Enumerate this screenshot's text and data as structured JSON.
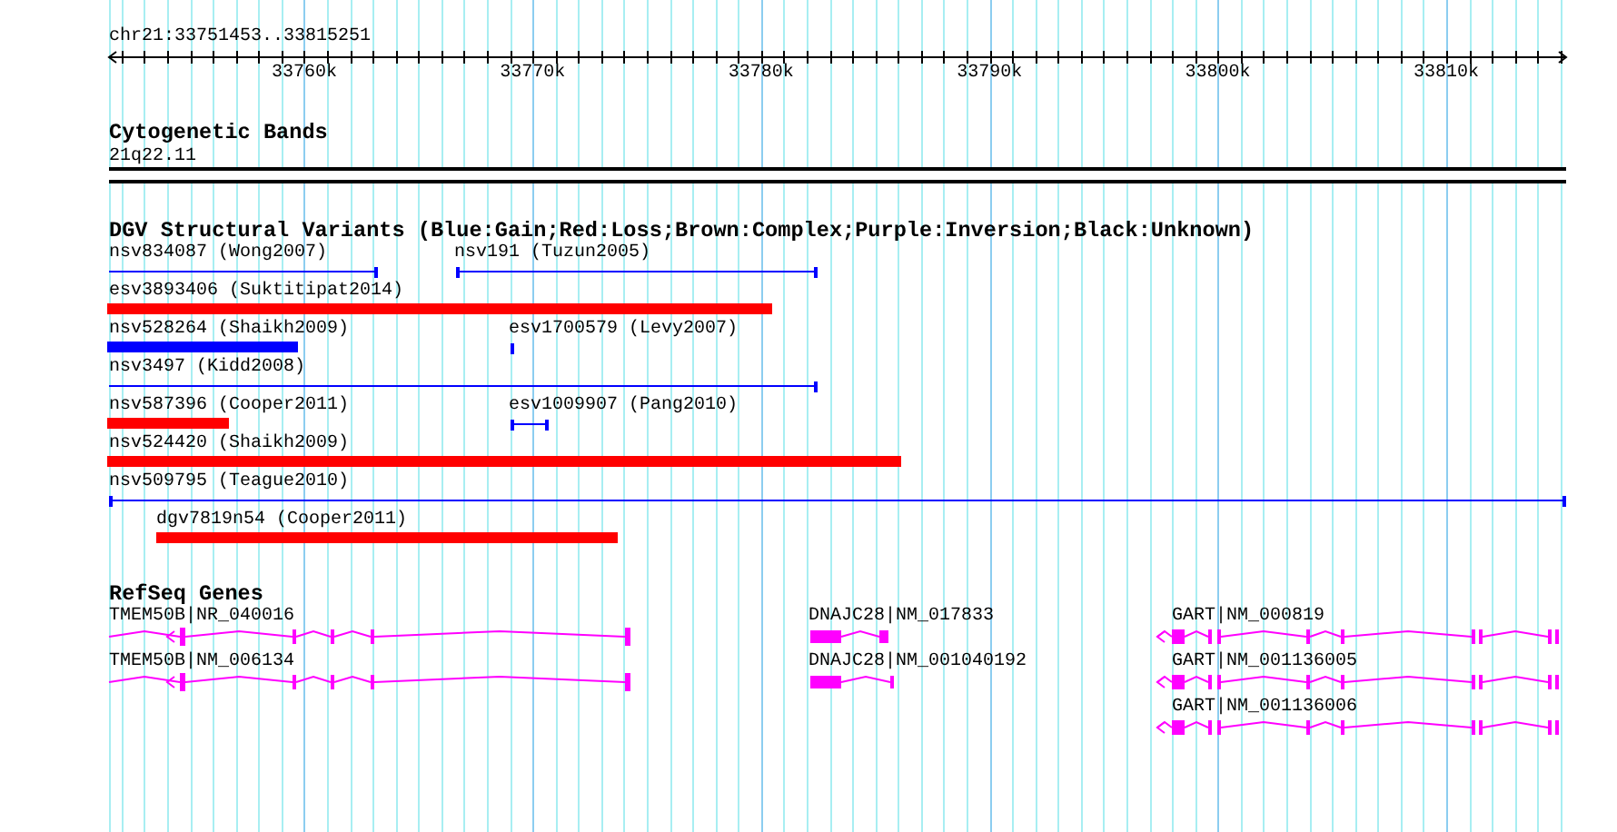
{
  "position": "chr21:33751453..33815251",
  "ruler": {
    "ticks": [
      "33760k",
      "33770k",
      "33780k",
      "33790k",
      "33800k",
      "33810k"
    ]
  },
  "cytogenetic_bands": {
    "title": "Cytogenetic Bands",
    "band": "21q22.11"
  },
  "dgv": {
    "title": "DGV Structural Variants (Blue:Gain;Red:Loss;Brown:Complex;Purple:Inversion;Black:Unknown)",
    "rows": [
      {
        "features": [
          {
            "label": "nsv834087 (Wong2007)",
            "color": "#0000ff",
            "kind": "line"
          },
          {
            "label": "nsv191 (Tuzun2005)",
            "color": "#0000ff",
            "kind": "line"
          }
        ]
      },
      {
        "features": [
          {
            "label": "esv3893406 (Suktitipat2014)",
            "color": "#ff0000",
            "kind": "bar"
          }
        ]
      },
      {
        "features": [
          {
            "label": "nsv528264 (Shaikh2009)",
            "color": "#0000ff",
            "kind": "bar"
          },
          {
            "label": "esv1700579 (Levy2007)",
            "color": "#0000ff",
            "kind": "line"
          }
        ]
      },
      {
        "features": [
          {
            "label": "nsv3497 (Kidd2008)",
            "color": "#0000ff",
            "kind": "line"
          }
        ]
      },
      {
        "features": [
          {
            "label": "nsv587396 (Cooper2011)",
            "color": "#ff0000",
            "kind": "bar"
          },
          {
            "label": "esv1009907 (Pang2010)",
            "color": "#0000ff",
            "kind": "line"
          }
        ]
      },
      {
        "features": [
          {
            "label": "nsv524420 (Shaikh2009)",
            "color": "#ff0000",
            "kind": "bar"
          }
        ]
      },
      {
        "features": [
          {
            "label": "nsv509795 (Teague2010)",
            "color": "#0000ff",
            "kind": "line"
          }
        ]
      },
      {
        "features": [
          {
            "label": "dgv7819n54 (Cooper2011)",
            "color": "#ff0000",
            "kind": "bar"
          }
        ]
      }
    ]
  },
  "refseq": {
    "title": "RefSeq Genes",
    "rows": [
      {
        "genes": [
          {
            "label": "TMEM50B|NR_040016"
          },
          {
            "label": "DNAJC28|NM_017833"
          },
          {
            "label": "GART|NM_000819"
          }
        ]
      },
      {
        "genes": [
          {
            "label": "TMEM50B|NM_006134"
          },
          {
            "label": "DNAJC28|NM_001040192"
          },
          {
            "label": "GART|NM_001136005"
          }
        ]
      },
      {
        "genes": [
          {
            "label": "GART|NM_001136006"
          }
        ]
      }
    ]
  }
}
